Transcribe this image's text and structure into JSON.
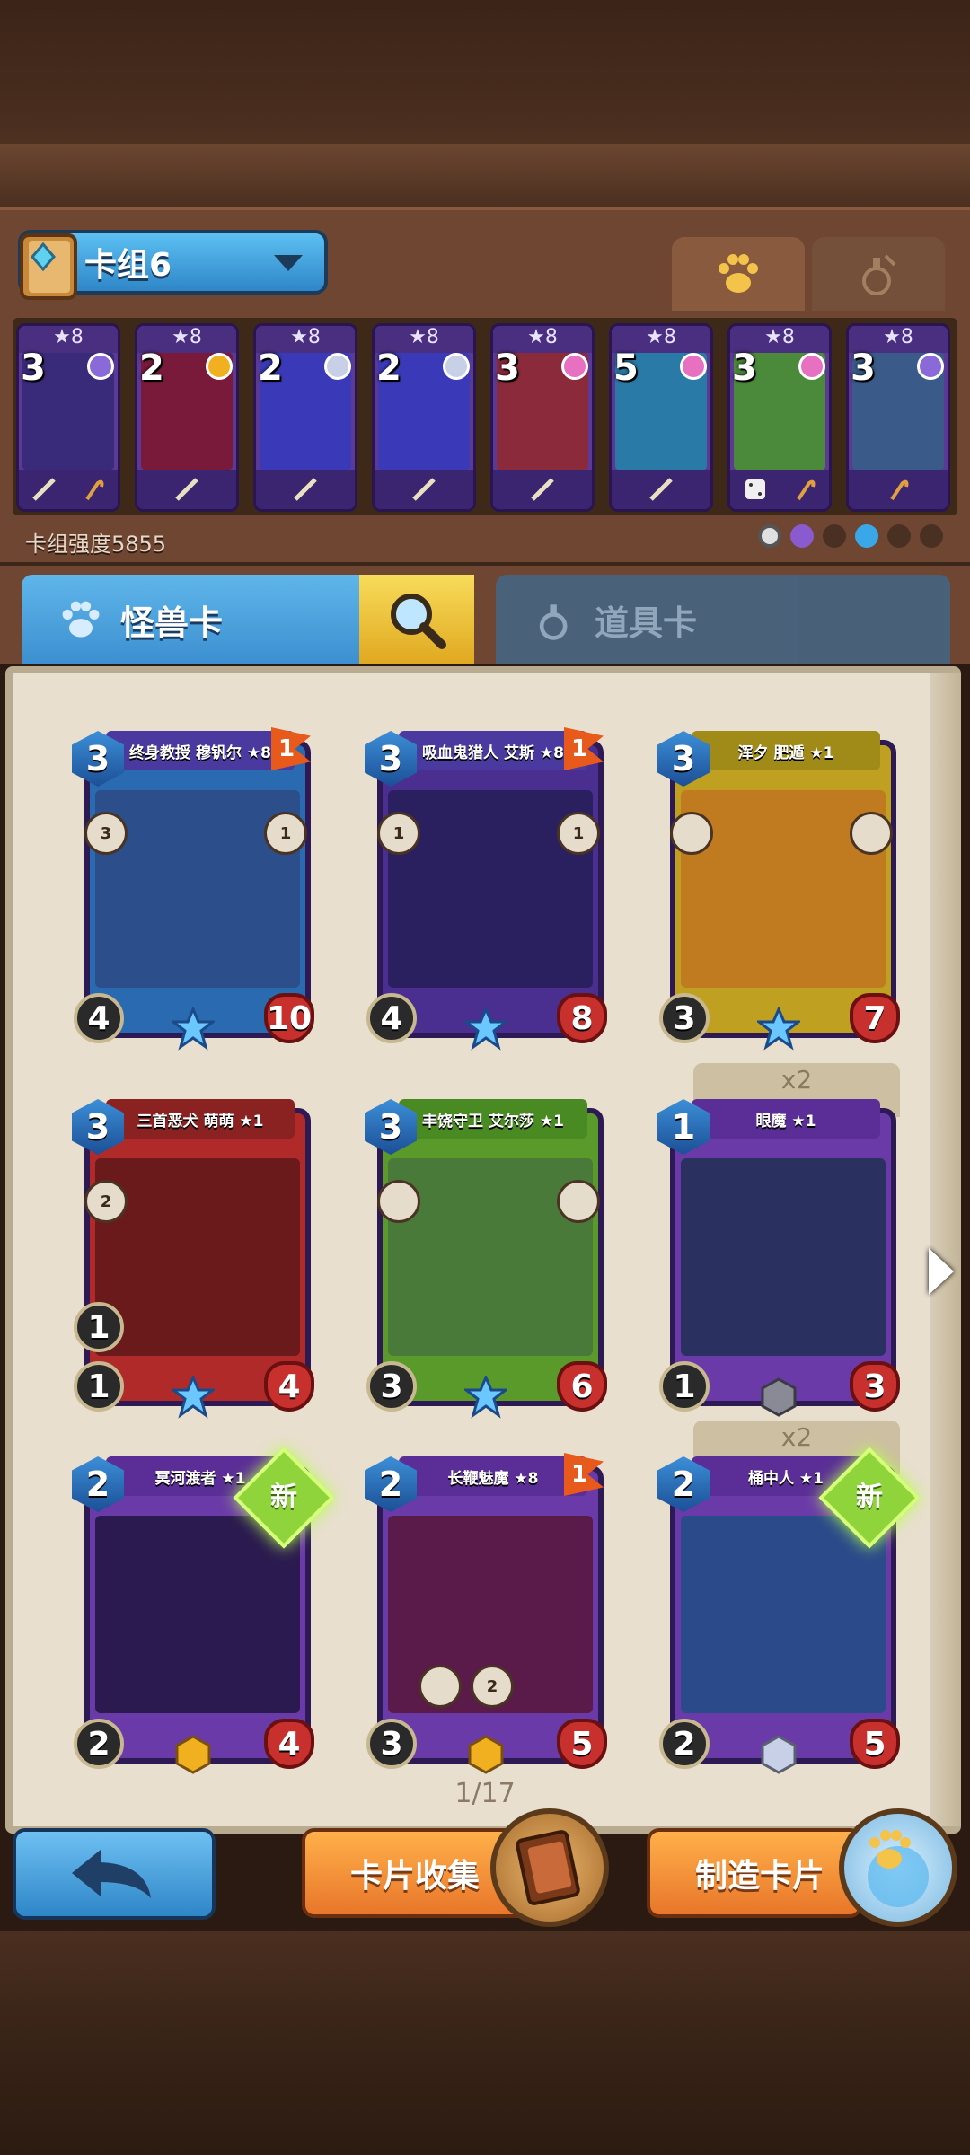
{
  "deck": {
    "name": "卡组6",
    "strength_label": "卡组强度5855"
  },
  "deck_cards": [
    {
      "stars": "★8",
      "cost": "3",
      "gem": "#8a6ad8",
      "art": "#3a2a7a"
    },
    {
      "stars": "★8",
      "cost": "2",
      "gem": "#f0b020",
      "art": "#7a1a3a"
    },
    {
      "stars": "★8",
      "cost": "2",
      "gem": "#c8d0e8",
      "art": "#3a3ab8"
    },
    {
      "stars": "★8",
      "cost": "2",
      "gem": "#c8d0e8",
      "art": "#3a3ab8"
    },
    {
      "stars": "★8",
      "cost": "3",
      "gem": "#e870c0",
      "art": "#8a2a3a"
    },
    {
      "stars": "★8",
      "cost": "5",
      "gem": "#e870c0",
      "art": "#2a7aa8"
    },
    {
      "stars": "★8",
      "cost": "3",
      "gem": "#e870c0",
      "art": "#4a8a3a"
    },
    {
      "stars": "★8",
      "cost": "3",
      "gem": "#8a6ad8",
      "art": "#3a5a8a"
    }
  ],
  "tabs": {
    "monster": "怪兽卡",
    "item": "道具卡"
  },
  "cards": [
    {
      "name": "终身教授 穆钒尔 ★8",
      "cost": "3",
      "atk": "4",
      "hp": "10",
      "flag": "1",
      "frame": "#2a6ab0",
      "art": "#2c4e8a",
      "abil_a": "3",
      "abil_b": "1",
      "dup": "",
      "new": ""
    },
    {
      "name": "吸血鬼猎人 艾斯 ★8",
      "cost": "3",
      "atk": "4",
      "hp": "8",
      "flag": "1",
      "frame": "#4a2e90",
      "art": "#2a2060",
      "abil_a": "1",
      "abil_b": "1",
      "dup": "",
      "new": ""
    },
    {
      "name": "浑夕 肥遁 ★1",
      "cost": "3",
      "atk": "3",
      "hp": "7",
      "flag": "",
      "frame": "#c0a020",
      "art": "#c07a20",
      "abil_a": "",
      "abil_b": "",
      "dup": "",
      "new": ""
    },
    {
      "name": "三首恶犬 萌萌 ★1",
      "cost": "3",
      "atk": "1",
      "hp": "4",
      "flag": "",
      "frame": "#b02a2a",
      "art": "#6a1a1a",
      "abil_a": "2",
      "abil_b": "",
      "dup": "",
      "new": ""
    },
    {
      "name": "丰饶守卫 艾尔莎 ★1",
      "cost": "3",
      "atk": "3",
      "hp": "6",
      "flag": "",
      "frame": "#5a9a2a",
      "art": "#4a7a3a",
      "abil_a": "",
      "abil_b": "",
      "dup": "",
      "new": ""
    },
    {
      "name": "眼魔 ★1",
      "cost": "1",
      "atk": "1",
      "hp": "3",
      "flag": "",
      "frame": "#6a3aa8",
      "art": "#2a3060",
      "abil_a": "",
      "abil_b": "",
      "dup": "x2",
      "new": ""
    },
    {
      "name": "冥河渡者 ★1",
      "cost": "2",
      "atk": "2",
      "hp": "4",
      "flag": "",
      "frame": "#6a3aa8",
      "art": "#2a1a50",
      "abil_a": "",
      "abil_b": "",
      "dup": "",
      "new": "新"
    },
    {
      "name": "长鞭魅魔 ★8",
      "cost": "2",
      "atk": "3",
      "hp": "5",
      "flag": "1",
      "frame": "#6a3aa8",
      "art": "#5a1a4a",
      "abil_a": "",
      "abil_b": "2",
      "dup": "",
      "new": ""
    },
    {
      "name": "桶中人 ★1",
      "cost": "2",
      "atk": "2",
      "hp": "5",
      "flag": "",
      "frame": "#6a3aa8",
      "art": "#2a4a8a",
      "abil_a": "",
      "abil_b": "",
      "dup": "x2",
      "new": "新"
    }
  ],
  "pager": "1/17",
  "buttons": {
    "collect": "卡片收集",
    "craft": "制造卡片"
  }
}
